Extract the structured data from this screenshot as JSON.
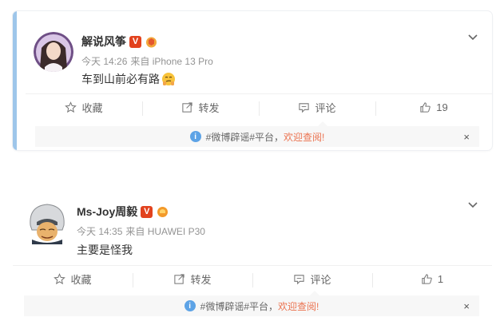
{
  "posts": [
    {
      "username": "解说风筝",
      "vip_badge": "V",
      "timestamp": "今天 14:26",
      "source": "来自 iPhone 13 Pro",
      "text": "车到山前必有路",
      "emoji": "smirk-emoji",
      "actions": {
        "favorite": "收藏",
        "repost": "转发",
        "comment": "评论",
        "like_count": "19"
      },
      "notice": {
        "prefix": "#微博辟谣#平台，",
        "link": "欢迎查阅!",
        "close": "×"
      }
    },
    {
      "username": "Ms-Joy周毅",
      "vip_badge": "V",
      "timestamp": "今天 14:35",
      "source": "来自 HUAWEI P30",
      "text": "主要是怪我",
      "actions": {
        "favorite": "收藏",
        "repost": "转发",
        "comment": "评论",
        "like_count": "1"
      },
      "notice": {
        "prefix": "#微博辟谣#平台，",
        "link": "欢迎查阅!",
        "close": "×"
      }
    }
  ],
  "colors": {
    "accent_link": "#eb7350",
    "vip_badge": "#e2421e",
    "info_icon": "#5da3e6",
    "card_highlight_bar": "#9ec6ea"
  },
  "icons": [
    "chevron-down-icon",
    "star-outline-icon",
    "repost-icon",
    "comment-icon",
    "thumbs-up-icon",
    "info-icon",
    "medal-icon"
  ]
}
